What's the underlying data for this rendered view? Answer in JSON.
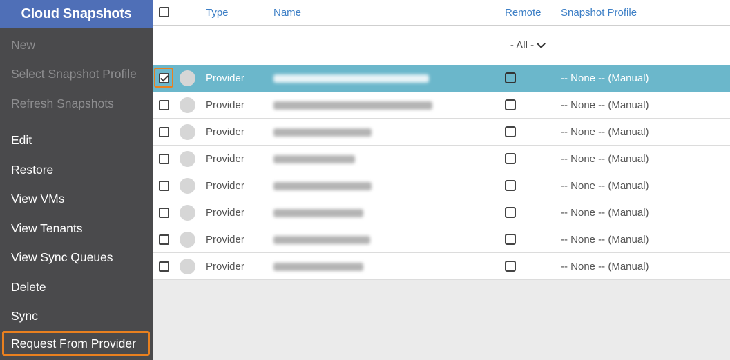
{
  "sidebar": {
    "title": "Cloud Snapshots",
    "items": [
      {
        "label": "New",
        "disabled": true
      },
      {
        "label": "Select Snapshot Profile",
        "disabled": true
      },
      {
        "label": "Refresh Snapshots",
        "disabled": true
      },
      {
        "label": "Edit",
        "disabled": false
      },
      {
        "label": "Restore",
        "disabled": false
      },
      {
        "label": "View VMs",
        "disabled": false
      },
      {
        "label": "View Tenants",
        "disabled": false
      },
      {
        "label": "View Sync Queues",
        "disabled": false
      },
      {
        "label": "Delete",
        "disabled": false
      },
      {
        "label": "Sync",
        "disabled": false
      },
      {
        "label": "Request From Provider",
        "disabled": false,
        "highlighted": true
      }
    ]
  },
  "table": {
    "columns": {
      "type": "Type",
      "name": "Name",
      "remote": "Remote",
      "profile": "Snapshot Profile"
    },
    "remote_filter": "- All -",
    "rows": [
      {
        "type": "Provider",
        "name_redacted": true,
        "profile": "-- None -- (Manual)",
        "selected": true
      },
      {
        "type": "Provider",
        "name_redacted": true,
        "profile": "-- None -- (Manual)",
        "selected": false
      },
      {
        "type": "Provider",
        "name_redacted": true,
        "profile": "-- None -- (Manual)",
        "selected": false
      },
      {
        "type": "Provider",
        "name_redacted": true,
        "profile": "-- None -- (Manual)",
        "selected": false
      },
      {
        "type": "Provider",
        "name_redacted": true,
        "profile": "-- None -- (Manual)",
        "selected": false
      },
      {
        "type": "Provider",
        "name_redacted": true,
        "profile": "-- None -- (Manual)",
        "selected": false
      },
      {
        "type": "Provider",
        "name_redacted": true,
        "profile": "-- None -- (Manual)",
        "selected": false
      },
      {
        "type": "Provider",
        "name_redacted": true,
        "profile": "-- None -- (Manual)",
        "selected": false
      }
    ]
  },
  "colors": {
    "sidebar_bg": "#4a4a4c",
    "header_bg": "#4f6fb7",
    "selected_row": "#6bb7cb",
    "highlight": "#e9801f",
    "link": "#3d7fc6"
  }
}
